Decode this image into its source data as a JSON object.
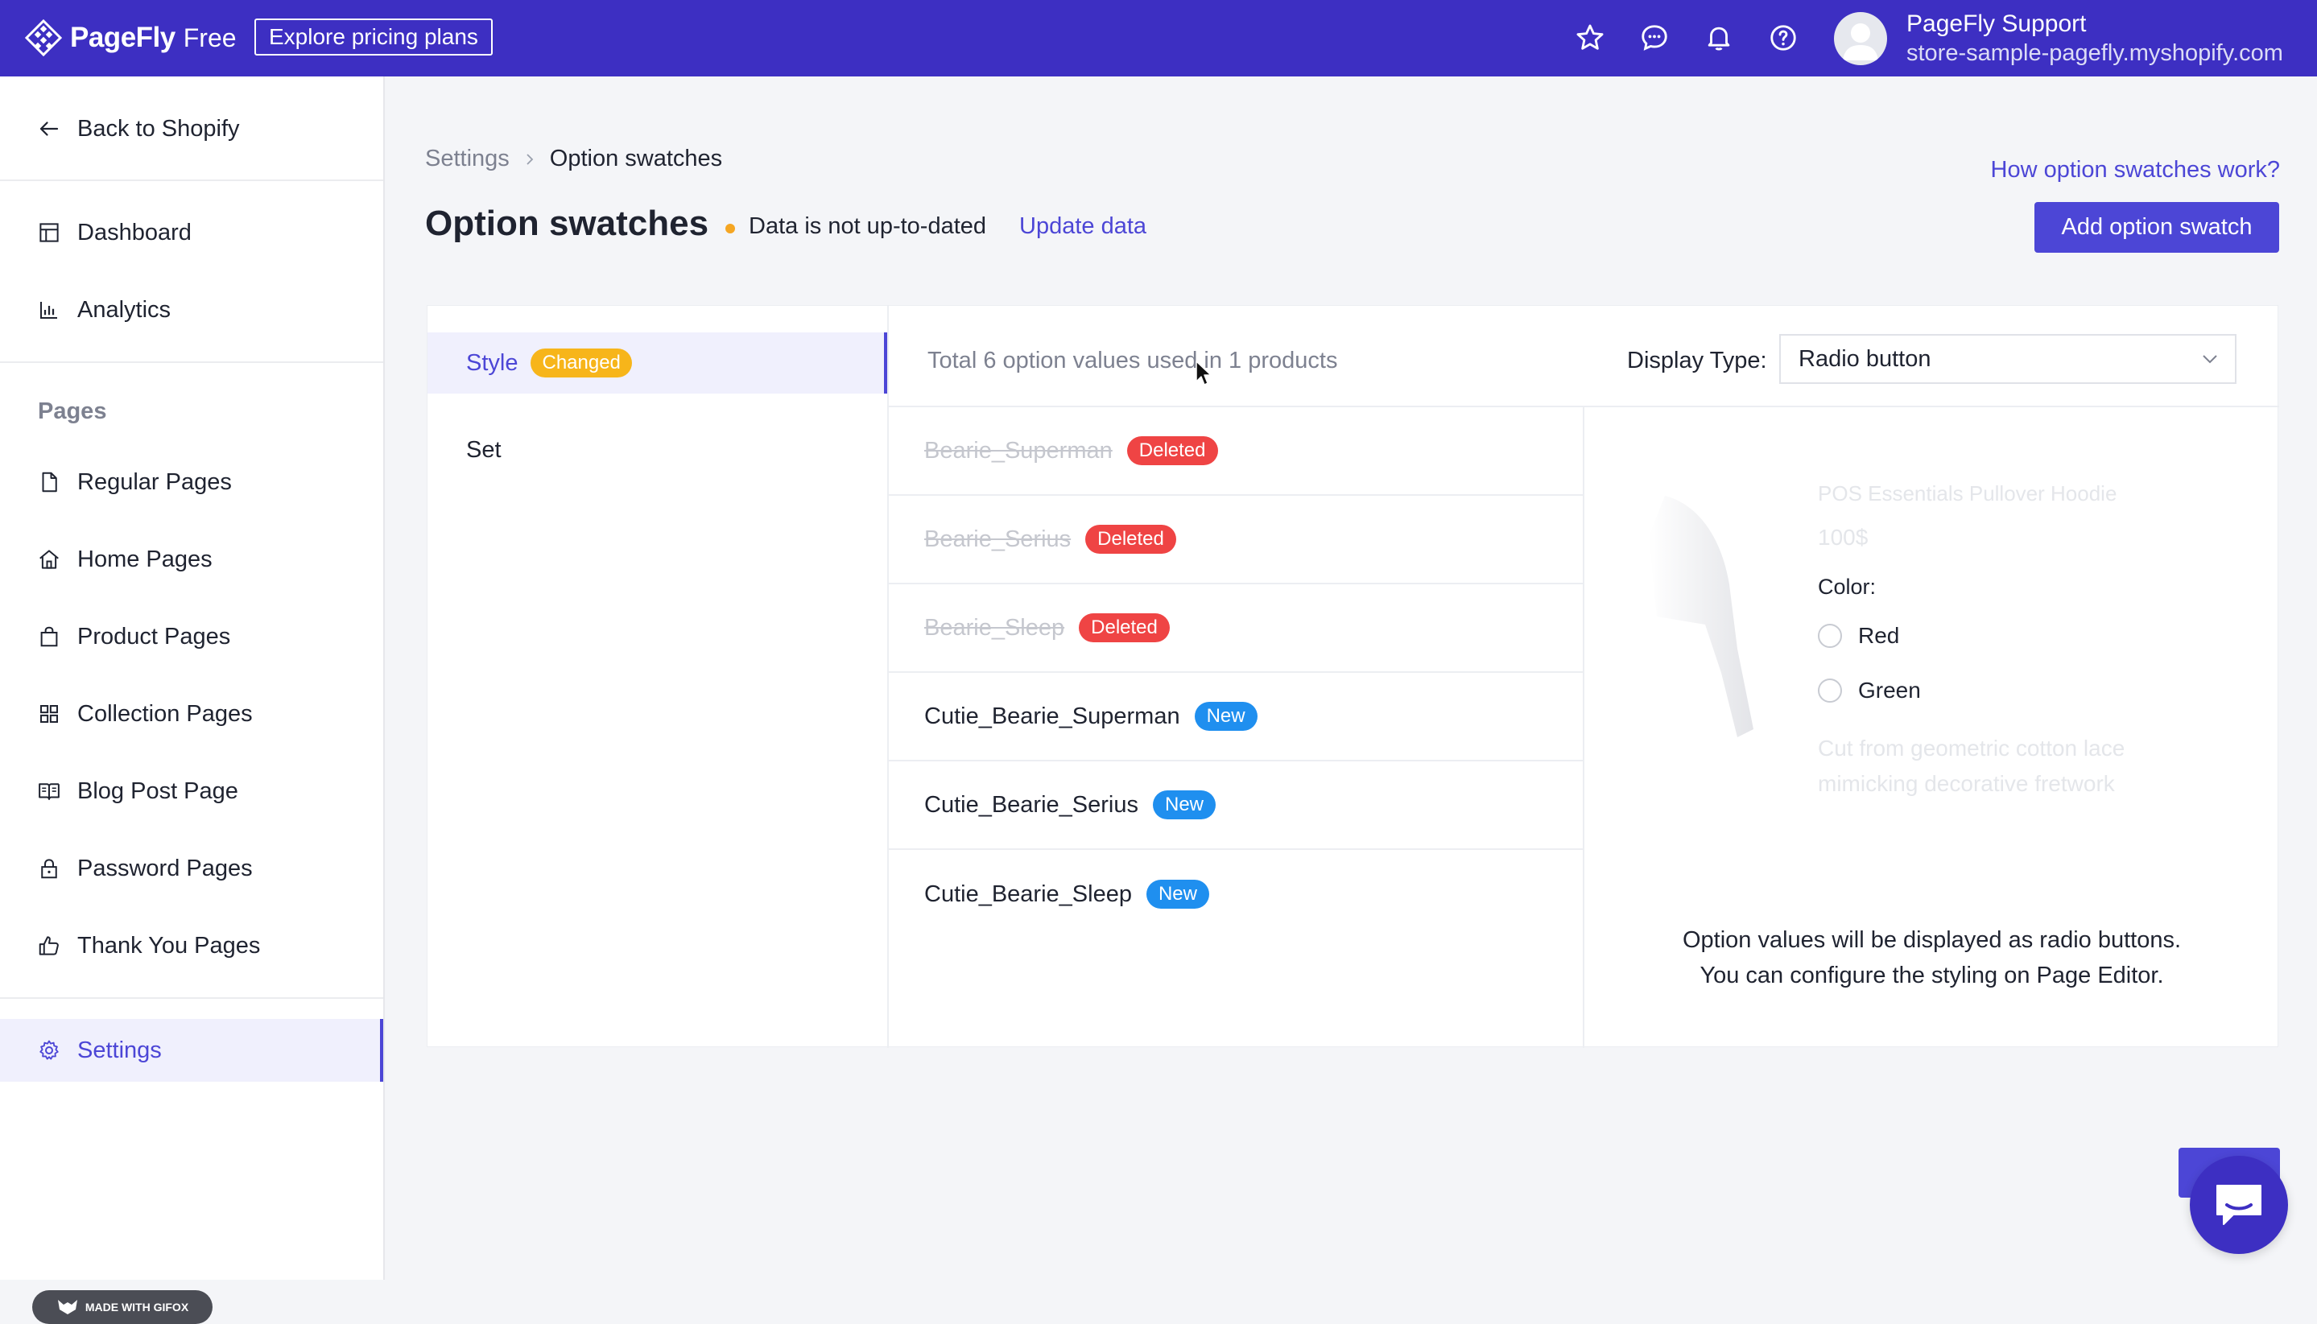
{
  "topbar": {
    "brand": "PageFly",
    "plan": "Free",
    "explore_label": "Explore pricing plans",
    "icons": [
      "star-icon",
      "chat-icon",
      "bell-icon",
      "help-icon"
    ],
    "user_name": "PageFly Support",
    "user_store": "store-sample-pagefly.myshopify.com"
  },
  "sidebar": {
    "back_label": "Back to Shopify",
    "dashboard": "Dashboard",
    "analytics": "Analytics",
    "pages_heading": "Pages",
    "pages": [
      {
        "label": "Regular Pages",
        "icon": "file-icon"
      },
      {
        "label": "Home Pages",
        "icon": "home-icon"
      },
      {
        "label": "Product Pages",
        "icon": "bag-icon"
      },
      {
        "label": "Collection Pages",
        "icon": "grid-icon"
      },
      {
        "label": "Blog Post Page",
        "icon": "book-icon"
      },
      {
        "label": "Password Pages",
        "icon": "lock-icon"
      },
      {
        "label": "Thank You Pages",
        "icon": "thumbs-up-icon"
      }
    ],
    "settings": "Settings",
    "gifox": "MADE WITH GIFOX"
  },
  "breadcrumb": {
    "parent": "Settings",
    "current": "Option swatches"
  },
  "header": {
    "title": "Option swatches",
    "status": "Data is not up-to-dated",
    "update_link": "Update data",
    "help_link": "How option swatches work?",
    "add_button": "Add option swatch"
  },
  "tabs": {
    "style": "Style",
    "style_badge": "Changed",
    "set": "Set"
  },
  "list": {
    "total": "Total 6 option values used in 1 products",
    "display_type_label": "Display Type:",
    "display_type_value": "Radio button",
    "values": [
      {
        "name": "Bearie_Superman",
        "badge": "Deleted"
      },
      {
        "name": "Bearie_Serius",
        "badge": "Deleted"
      },
      {
        "name": "Bearie_Sleep",
        "badge": "Deleted"
      },
      {
        "name": "Cutie_Bearie_Superman",
        "badge": "New"
      },
      {
        "name": "Cutie_Bearie_Serius",
        "badge": "New"
      },
      {
        "name": "Cutie_Bearie_Sleep",
        "badge": "New"
      }
    ]
  },
  "preview": {
    "faded_title": "POS Essentials Pullover Hoodie",
    "price": "100$",
    "color_label": "Color:",
    "options": [
      "Red",
      "Green"
    ],
    "faded_desc_1": "Cut from geometric cotton lace",
    "faded_desc_2": "mimicking decorative fretwork",
    "note_1": "Option values will be displayed as radio buttons.",
    "note_2": "You can configure the styling on Page Editor."
  },
  "colors": {
    "brand": "#3d2fc2",
    "accent": "#4c46d6",
    "changed": "#f7b51a",
    "deleted": "#ef4444",
    "new": "#1f8fef"
  }
}
